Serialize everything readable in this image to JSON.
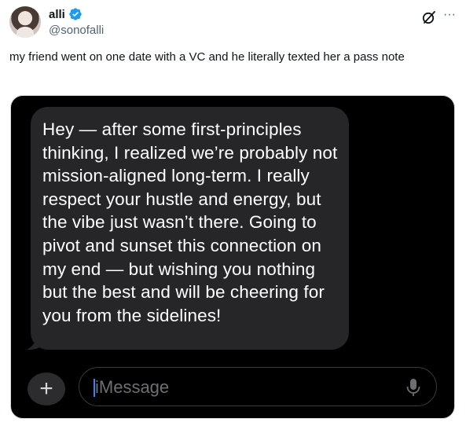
{
  "author": {
    "name": "alli",
    "handle": "@sonofalli",
    "verified": true,
    "verified_color": "#1d9bf0"
  },
  "header_icons": [
    "grok-icon",
    "more-icon"
  ],
  "more_label": "···",
  "tweet": {
    "text": "my friend went on one date with a VC and he literally texted her a pass note"
  },
  "media": {
    "message_text": "Hey — after some first-principles thinking, I realized we’re probably not mission-aligned long-term. I really respect your hustle and energy, but the vibe just wasn’t there. Going to pivot and sunset this connection on my end — but wishing you nothing but the best and will be cheering for you from the sidelines!",
    "plus_label": "+",
    "input_placeholder": "iMessage"
  }
}
